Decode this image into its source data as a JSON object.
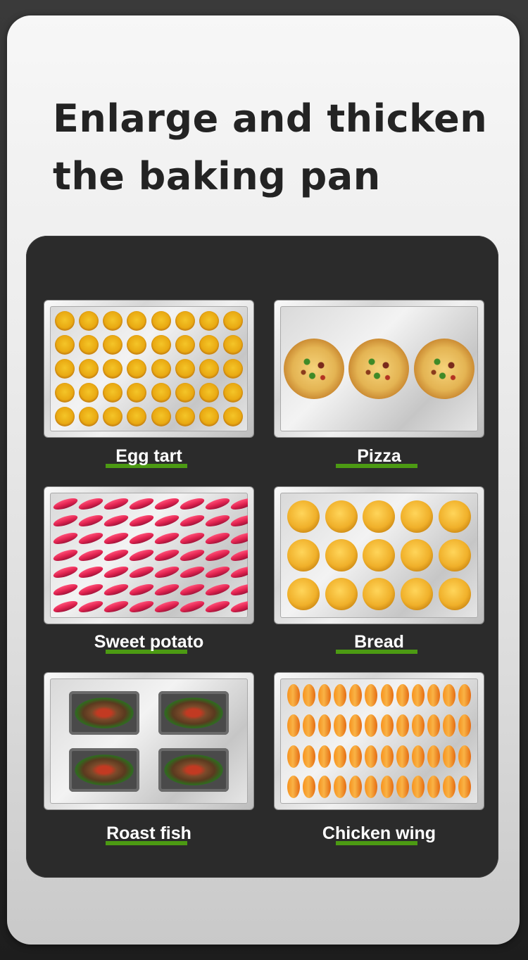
{
  "headline": {
    "line1": "Enlarge and thicken",
    "line2": "the baking pan"
  },
  "trays": [
    {
      "label": "Egg tart",
      "food": "egg-tart",
      "rows": 5,
      "cols": 8
    },
    {
      "label": "Pizza",
      "food": "pizza",
      "rows": 1,
      "cols": 3
    },
    {
      "label": "Sweet potato",
      "food": "sweet-potato",
      "rows": 7,
      "cols": 8
    },
    {
      "label": "Bread",
      "food": "bread",
      "rows": 3,
      "cols": 5
    },
    {
      "label": "Roast fish",
      "food": "roast-fish",
      "rows": 2,
      "cols": 2
    },
    {
      "label": "Chicken wing",
      "food": "chicken-wing",
      "rows": 4,
      "cols": 12
    }
  ],
  "colors": {
    "underline_accent": "#4c9a13",
    "panel_background": "#2b2b2b",
    "headline_text": "#232323"
  }
}
